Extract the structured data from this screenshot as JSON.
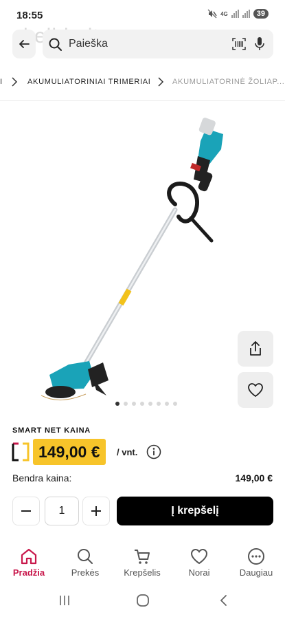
{
  "status_bar": {
    "time": "18:55",
    "network": "4G",
    "battery": "39"
  },
  "watermark": "skelbiu.lt",
  "search": {
    "placeholder": "Paieška"
  },
  "breadcrumb": {
    "items": [
      {
        "label": "I"
      },
      {
        "label": "AKUMULIATORINIAI TRIMERIAI"
      },
      {
        "label": "AKUMULIATORINĖ ŽOLIAP..."
      }
    ]
  },
  "product": {
    "gallery": {
      "image_count": 8,
      "active_index": 1
    },
    "price_label": "SMART NET KAINA",
    "price": "149,00 €",
    "unit": "/ vnt.",
    "total_label": "Bendra kaina:",
    "total_value": "149,00 €",
    "quantity": "1",
    "add_to_cart": "Į krepšelį"
  },
  "bottom_nav": {
    "items": [
      {
        "label": "Pradžia",
        "icon": "home-icon",
        "active": true
      },
      {
        "label": "Prekės",
        "icon": "search-icon"
      },
      {
        "label": "Krepšelis",
        "icon": "cart-icon"
      },
      {
        "label": "Norai",
        "icon": "heart-icon"
      },
      {
        "label": "Daugiau",
        "icon": "more-icon"
      }
    ]
  },
  "colors": {
    "accent": "#c8174b",
    "price_badge": "#f7c42a",
    "cart_button": "#000000"
  }
}
